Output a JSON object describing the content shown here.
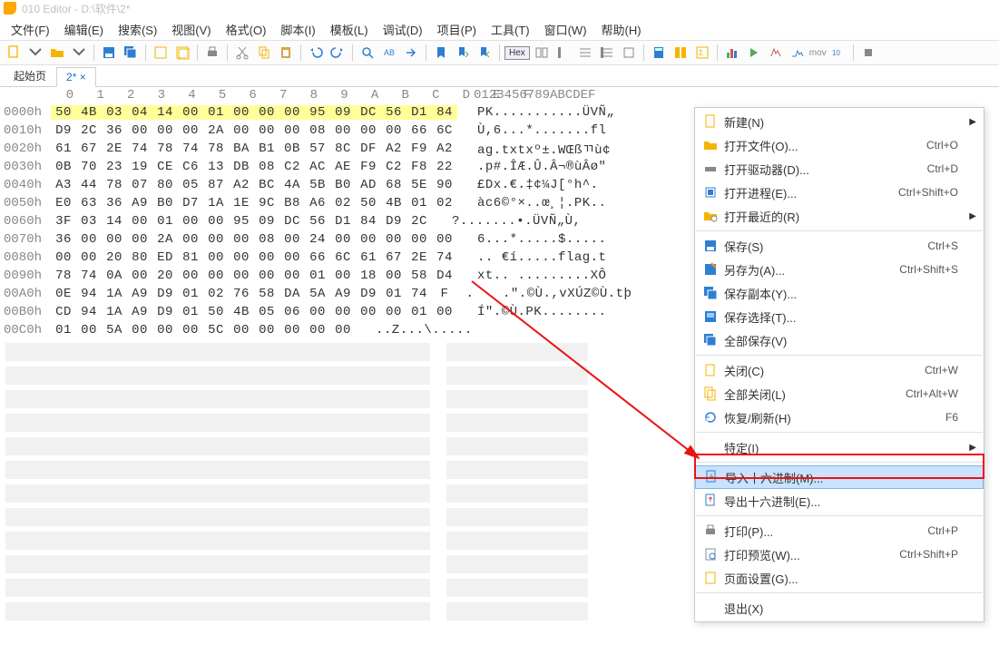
{
  "title": "010 Editor - D:\\软件\\2*",
  "menus": [
    "文件(F)",
    "编辑(E)",
    "搜索(S)",
    "视图(V)",
    "格式(O)",
    "脚本(I)",
    "模板(L)",
    "调试(D)",
    "项目(P)",
    "工具(T)",
    "窗口(W)",
    "帮助(H)"
  ],
  "tabs": {
    "start": "起始页",
    "active": "2* ×"
  },
  "hex": {
    "colhead_hex": "  0   1   2   3   4   5   6   7   8   9   A   B   C   D   E   F",
    "colhead_ascii": "0123456789ABCDEF",
    "rows": [
      {
        "addr": "0000h",
        "bytes": [
          "50",
          "4B",
          "03",
          "04",
          "14",
          "00",
          "01",
          "00",
          "00",
          "00",
          "95",
          "09",
          "DC",
          "56",
          "D1",
          "84"
        ],
        "hl": 16,
        "ascii": "PK...........ÜVÑ„"
      },
      {
        "addr": "0010h",
        "bytes": [
          "D9",
          "2C",
          "36",
          "00",
          "00",
          "00",
          "2A",
          "00",
          "00",
          "00",
          "08",
          "00",
          "00",
          "00",
          "66",
          "6C"
        ],
        "hl": 0,
        "ascii": "Ù,6...*.......fl"
      },
      {
        "addr": "0020h",
        "bytes": [
          "61",
          "67",
          "2E",
          "74",
          "78",
          "74",
          "78",
          "BA",
          "B1",
          "0B",
          "57",
          "8C",
          "DF",
          "A2",
          "F9",
          "A2"
        ],
        "hl": 0,
        "ascii": "ag.txtxº±.WŒßﾢù¢"
      },
      {
        "addr": "0030h",
        "bytes": [
          "0B",
          "70",
          "23",
          "19",
          "CE",
          "C6",
          "13",
          "DB",
          "08",
          "C2",
          "AC",
          "AE",
          "F9",
          "C2",
          "F8",
          "22"
        ],
        "hl": 0,
        "ascii": ".p#.ÎÆ.Û.Â¬®ùÂø\""
      },
      {
        "addr": "0040h",
        "bytes": [
          "A3",
          "44",
          "78",
          "07",
          "80",
          "05",
          "87",
          "A2",
          "BC",
          "4A",
          "5B",
          "B0",
          "AD",
          "68",
          "5E",
          "90"
        ],
        "hl": 0,
        "ascii": "£Dx.€.‡¢¼J[°­h^."
      },
      {
        "addr": "0050h",
        "bytes": [
          "E0",
          "63",
          "36",
          "A9",
          "B0",
          "D7",
          "1A",
          "1E",
          "9C",
          "B8",
          "A6",
          "02",
          "50",
          "4B",
          "01",
          "02"
        ],
        "hl": 0,
        "ascii": "àc6©°×..œ¸¦.PK.."
      },
      {
        "addr": "0060h",
        "bytes": [
          "3F",
          "03",
          "14",
          "00",
          "01",
          "00",
          "00",
          "95",
          "09",
          "DC",
          "56",
          "D1",
          "84",
          "D9",
          "2C"
        ],
        "hl": 0,
        "ascii": "?.......•.ÜVÑ„Ù,"
      },
      {
        "addr": "0070h",
        "bytes": [
          "36",
          "00",
          "00",
          "00",
          "2A",
          "00",
          "00",
          "00",
          "08",
          "00",
          "24",
          "00",
          "00",
          "00",
          "00",
          "00"
        ],
        "hl": 0,
        "ascii": "6...*.....$....."
      },
      {
        "addr": "0080h",
        "bytes": [
          "00",
          "00",
          "20",
          "80",
          "ED",
          "81",
          "00",
          "00",
          "00",
          "00",
          "66",
          "6C",
          "61",
          "67",
          "2E",
          "74"
        ],
        "hl": 0,
        "ascii": ".. €í.....flag.t"
      },
      {
        "addr": "0090h",
        "bytes": [
          "78",
          "74",
          "0A",
          "00",
          "20",
          "00",
          "00",
          "00",
          "00",
          "00",
          "01",
          "00",
          "18",
          "00",
          "58",
          "D4"
        ],
        "hl": 0,
        "ascii": "xt.. .........XÔ"
      },
      {
        "addr": "00A0h",
        "bytes": [
          "0E",
          "94",
          "1A",
          "A9",
          "D9",
          "01",
          "02",
          "76",
          "58",
          "DA",
          "5A",
          "A9",
          "D9",
          "01",
          "74",
          "F",
          "."
        ],
        "hl": 0,
        "ascii": ".\".©Ù.,vXÚZ©Ù.tþ"
      },
      {
        "addr": "00B0h",
        "bytes": [
          "CD",
          "94",
          "1A",
          "A9",
          "D9",
          "01",
          "50",
          "4B",
          "05",
          "06",
          "00",
          "00",
          "00",
          "00",
          "01",
          "00"
        ],
        "hl": 0,
        "ascii": "Í\".©Ù.PK........"
      },
      {
        "addr": "00C0h",
        "bytes": [
          "01",
          "00",
          "5A",
          "00",
          "00",
          "00",
          "5C",
          "00",
          "00",
          "00",
          "00",
          "00"
        ],
        "hl": 0,
        "ascii": "..Z...\\....."
      }
    ]
  },
  "context_menu": {
    "new": "新建(N)",
    "open_file": {
      "l": "打开文件(O)...",
      "k": "Ctrl+O"
    },
    "open_drive": {
      "l": "打开驱动器(D)...",
      "k": "Ctrl+D"
    },
    "open_process": {
      "l": "打开进程(E)...",
      "k": "Ctrl+Shift+O"
    },
    "open_recent": "打开最近的(R)",
    "save": {
      "l": "保存(S)",
      "k": "Ctrl+S"
    },
    "save_as": {
      "l": "另存为(A)...",
      "k": "Ctrl+Shift+S"
    },
    "save_copy": "保存副本(Y)...",
    "save_sel": "保存选择(T)...",
    "save_all": "全部保存(V)",
    "close": {
      "l": "关闭(C)",
      "k": "Ctrl+W"
    },
    "close_all": {
      "l": "全部关闭(L)",
      "k": "Ctrl+Alt+W"
    },
    "revert": {
      "l": "恢复/刷新(H)",
      "k": "F6"
    },
    "specific": "特定(I)",
    "import_hex": "导入十六进制(M)...",
    "export_hex": "导出十六进制(E)...",
    "print": {
      "l": "打印(P)...",
      "k": "Ctrl+P"
    },
    "print_preview": {
      "l": "打印预览(W)...",
      "k": "Ctrl+Shift+P"
    },
    "page_setup": "页面设置(G)...",
    "exit": "退出(X)"
  }
}
